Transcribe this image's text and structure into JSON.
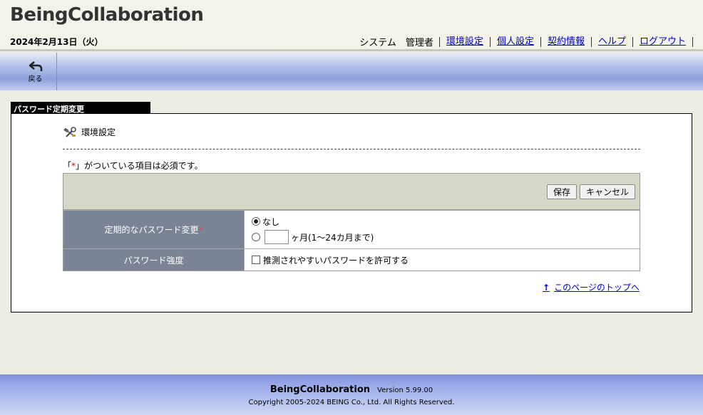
{
  "header": {
    "app_title": "BeingCollaboration",
    "date": "2024年2月13日（火）",
    "user_static": "システム　管理者",
    "nav": [
      "環境設定",
      "個人設定",
      "契約情報",
      "ヘルプ",
      "ログアウト"
    ]
  },
  "toolbar": {
    "back_label": "戻る"
  },
  "panel": {
    "title": "パスワード定期変更",
    "breadcrumb": "環境設定",
    "required_note_prefix": "「",
    "required_mark": "*",
    "required_note_suffix": "」がついている項目は必須です。",
    "buttons": {
      "save": "保存",
      "cancel": "キャンセル"
    },
    "rows": [
      {
        "label": "定期的なパスワード変更",
        "required": "*",
        "options": [
          {
            "label": "なし",
            "checked": true
          },
          {
            "label_suffix": "ヶ月(1〜24カ月まで)",
            "checked": false,
            "input_value": ""
          }
        ]
      },
      {
        "label": "パスワード強度",
        "checkbox_label": "推測されやすいパスワードを許可する",
        "checked": false
      }
    ],
    "page_top_link": "このページのトップへ"
  },
  "footer": {
    "brand": "BeingCollaboration",
    "version": "Version 5.99.00",
    "copyright": "Copyright 2005-2024 BEING Co., Ltd. All Rights Reserved."
  },
  "colors": {
    "link": "#0000cc",
    "label_bg": "#7b8494",
    "required": "#cc0000"
  }
}
